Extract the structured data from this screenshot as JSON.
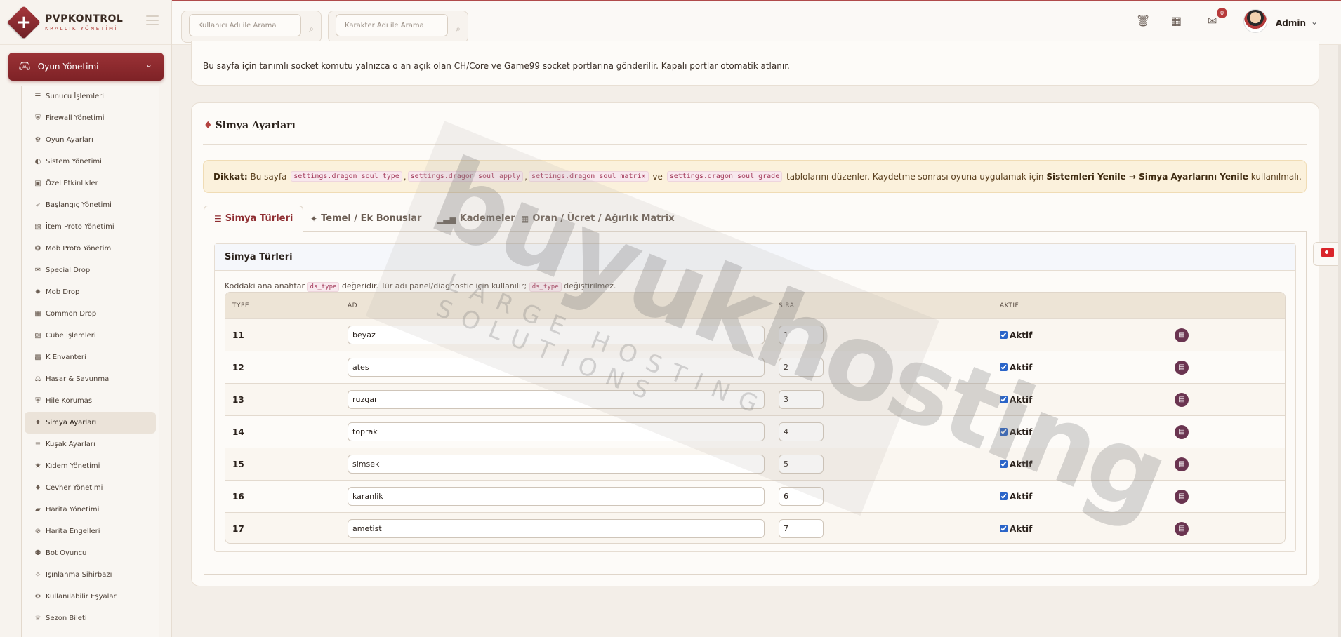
{
  "brand": {
    "title": "PVPKONTROL",
    "subtitle": "KRALLIK YÖNETİMİ"
  },
  "header": {
    "search_user_placeholder": "Kullanıcı Adı ile Arama",
    "search_char_placeholder": "Karakter Adı ile Arama",
    "notification_count": "0",
    "admin_name": "Admin"
  },
  "sidebar": {
    "section_label": "Oyun Yönetimi",
    "items": [
      {
        "label": "Sunucu İşlemleri",
        "icon": "server-icon"
      },
      {
        "label": "Firewall Yönetimi",
        "icon": "shield-icon"
      },
      {
        "label": "Oyun Ayarları",
        "icon": "cogs-icon"
      },
      {
        "label": "Sistem Yönetimi",
        "icon": "toggle-icon"
      },
      {
        "label": "Özel Etkinlikler",
        "icon": "gamepad-icon"
      },
      {
        "label": "Başlangıç Yönetimi",
        "icon": "rocket-icon"
      },
      {
        "label": "İtem Proto Yönetimi",
        "icon": "box-icon"
      },
      {
        "label": "Mob Proto Yönetimi",
        "icon": "paw-icon"
      },
      {
        "label": "Special Drop",
        "icon": "gift-icon"
      },
      {
        "label": "Mob Drop",
        "icon": "bug-icon"
      },
      {
        "label": "Common Drop",
        "icon": "table-icon"
      },
      {
        "label": "Cube İşlemleri",
        "icon": "cube-icon"
      },
      {
        "label": "K Envanteri",
        "icon": "grid-icon"
      },
      {
        "label": "Hasar & Savunma",
        "icon": "balance-icon"
      },
      {
        "label": "Hile Koruması",
        "icon": "shield-icon"
      },
      {
        "label": "Simya Ayarları",
        "icon": "gem-icon"
      },
      {
        "label": "Kuşak Ayarları",
        "icon": "sliders-icon"
      },
      {
        "label": "Kıdem Yönetimi",
        "icon": "star-icon"
      },
      {
        "label": "Cevher Yönetimi",
        "icon": "gem-icon"
      },
      {
        "label": "Harita Yönetimi",
        "icon": "map-icon"
      },
      {
        "label": "Harita Engelleri",
        "icon": "ban-icon"
      },
      {
        "label": "Bot Oyuncu",
        "icon": "robot-icon"
      },
      {
        "label": "Işınlanma Sihirbazı",
        "icon": "magic-icon"
      },
      {
        "label": "Kullanılabilir Eşyalar",
        "icon": "cogs-icon"
      },
      {
        "label": "Sezon Bileti",
        "icon": "trophy-icon"
      }
    ]
  },
  "info": {
    "text": "Bu sayfa için tanımlı socket komutu yalnızca o an açık olan CH/Core ve Game99 socket portlarına gönderilir. Kapalı portlar otomatik atlanır."
  },
  "page": {
    "title": "Simya Ayarları"
  },
  "alert": {
    "label": "Dikkat:",
    "text1": "Bu sayfa",
    "code1": "settings.dragon_soul_type",
    "sep1": ",",
    "code2": "settings.dragon_soul_apply",
    "sep2": ",",
    "code3": "settings.dragon_soul_matrix",
    "ve": "ve",
    "code4": "settings.dragon_soul_grade",
    "text2": "tablolarını düzenler. Kaydetme sonrası oyuna uygulamak için",
    "path": "Sistemleri Yenile → Simya Ayarlarını Yenile",
    "text3": "kullanılmalı."
  },
  "tabs": [
    {
      "label": "Simya Türleri",
      "icon": "list-icon"
    },
    {
      "label": "Temel / Ek Bonuslar",
      "icon": "wand-icon"
    },
    {
      "label": "Kademeler",
      "icon": "bars-icon"
    },
    {
      "label": "Oran / Ücret / Ağırlık Matrix",
      "icon": "table-icon"
    }
  ],
  "section": {
    "title": "Simya Türleri",
    "note_pre": "Koddaki ana anahtar",
    "note_code1": "ds_type",
    "note_mid": "değeridir. Tür adı panel/diagnostic için kullanılır;",
    "note_code2": "ds_type",
    "note_post": "değiştirilmez."
  },
  "table": {
    "headers": {
      "type": "TYPE",
      "ad": "AD",
      "sira": "SIRA",
      "aktif": "AKTİF"
    },
    "aktif_label": "Aktif",
    "rows": [
      {
        "type": "11",
        "ad": "beyaz",
        "sira": "1"
      },
      {
        "type": "12",
        "ad": "ates",
        "sira": "2"
      },
      {
        "type": "13",
        "ad": "ruzgar",
        "sira": "3"
      },
      {
        "type": "14",
        "ad": "toprak",
        "sira": "4"
      },
      {
        "type": "15",
        "ad": "simsek",
        "sira": "5"
      },
      {
        "type": "16",
        "ad": "karanlik",
        "sira": "6"
      },
      {
        "type": "17",
        "ad": "ametist",
        "sira": "7"
      }
    ]
  },
  "watermark": {
    "main": "buyukhosting",
    "sub": "LARGE HOSTING SOLUTIONS"
  }
}
